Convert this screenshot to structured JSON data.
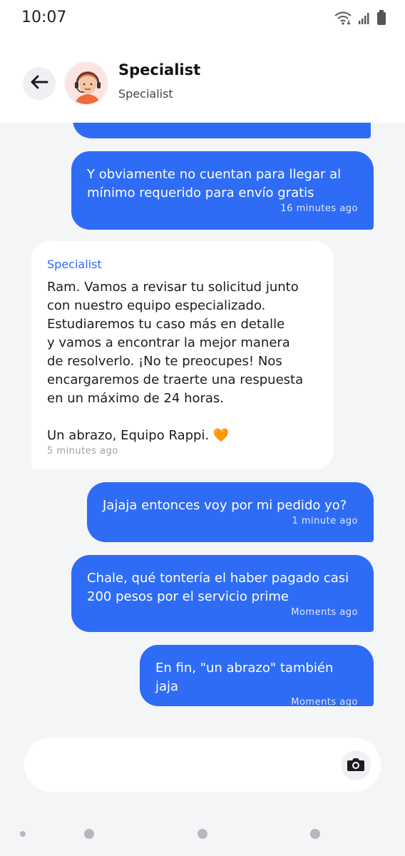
{
  "status_bar": {
    "time": "10:07",
    "icons": [
      "wifi-icon",
      "signal-icon",
      "battery-icon"
    ]
  },
  "header": {
    "back_icon": "arrow-left-icon",
    "title": "Specialist",
    "subtitle": "Specialist"
  },
  "colors": {
    "accent": "#2f6cf6",
    "chat_background": "#f4f5f7",
    "incoming_bubble": "#ffffff"
  },
  "messages": [
    {
      "direction": "out",
      "text": "Y obviamente no cuentan para llegar al\nmínimo requerido para envío gratis",
      "time": "16 minutes ago"
    },
    {
      "direction": "in",
      "sender": "Specialist",
      "text": "Ram. Vamos a revisar tu solicitud junto\ncon nuestro equipo especializado.\nEstudiaremos tu caso más en detalle\ny vamos a encontrar la mejor manera\nde resolverlo. ¡No te preocupes! Nos\nencargaremos de traerte una respuesta\nen un máximo de 24 horas.\n\nUn abrazo, Equipo Rappi. 🧡",
      "time": "5 minutes ago"
    },
    {
      "direction": "out",
      "text": "Jajaja entonces voy por mi pedido yo?",
      "time": "1 minute ago"
    },
    {
      "direction": "out",
      "text": "Chale, qué tontería el haber pagado casi\n200 pesos por el servicio prime",
      "time": "Moments ago"
    },
    {
      "direction": "out",
      "text": "En fin, \"un abrazo\" también jaja",
      "time": "Moments ago"
    }
  ],
  "composer": {
    "camera_icon": "camera-icon"
  }
}
